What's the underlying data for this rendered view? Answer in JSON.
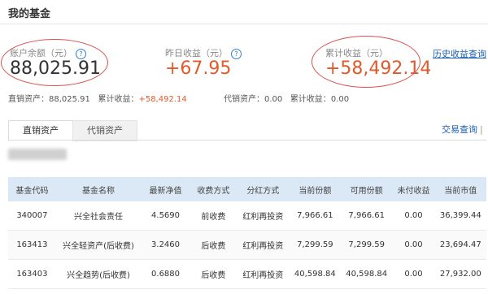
{
  "page": {
    "title": "我的基金"
  },
  "summary": {
    "balance_label": "账户余额（元）",
    "balance_value": "88,025.91",
    "yesterday_label": "昨日收益（元）",
    "yesterday_value": "+67.95",
    "cumulative_label": "累计收益（元）",
    "cumulative_value": "+58,492.14",
    "history_link": "历史收益查询",
    "help_glyph": "?"
  },
  "sub": {
    "direct_assets_label": "直销资产：",
    "direct_assets_value": "88,025.91",
    "direct_income_label": "累计收益：",
    "direct_income_value": "+58,492.14",
    "agency_assets_label": "代销资产：",
    "agency_assets_value": "0.00",
    "agency_income_label": "累计收益：",
    "agency_income_value": "0.00"
  },
  "tabs": [
    "直销资产",
    "代销资产"
  ],
  "trade_query_link": "交易查询",
  "table": {
    "headers": [
      "基金代码",
      "基金名称",
      "最新净值",
      "收费方式",
      "分红方式",
      "当前份额",
      "可用份额",
      "未付收益",
      "当前市值"
    ],
    "rows": [
      [
        "340007",
        "兴全社会责任",
        "4.5690",
        "前收费",
        "红利再投资",
        "7,966.61",
        "7,966.61",
        "0.00",
        "36,399.44"
      ],
      [
        "163413",
        "兴全轻资产(后收费)",
        "3.2460",
        "后收费",
        "红利再投资",
        "7,299.59",
        "7,299.59",
        "0.00",
        "23,694.47"
      ],
      [
        "163403",
        "兴全趋势(后收费)",
        "0.6880",
        "后收费",
        "红利再投资",
        "40,598.84",
        "40,598.84",
        "0.00",
        "27,932.00"
      ]
    ]
  },
  "colors": {
    "accent_red": "#e05a2b",
    "link_blue": "#1a5fb4",
    "annotation_red": "#d9534f",
    "header_bg": "#dbe8f5"
  }
}
